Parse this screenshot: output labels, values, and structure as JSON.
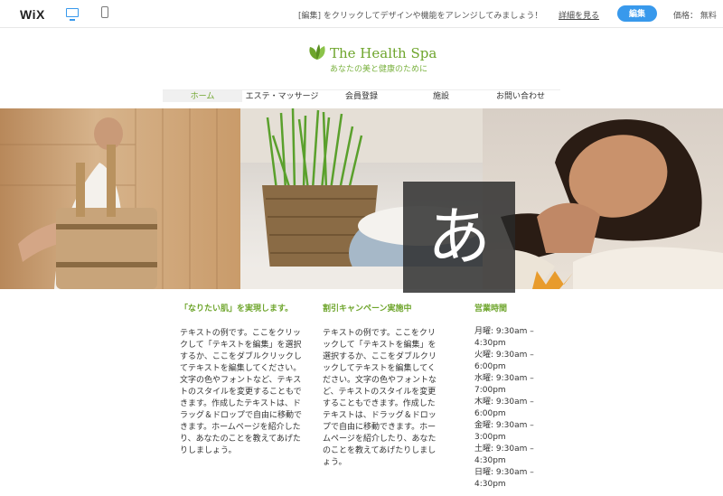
{
  "editor_bar": {
    "logo": "WiX",
    "promo": "[編集] をクリックしてデザインや機能をアレンジしてみましょう！",
    "details_link": "詳細を見る",
    "edit_button": "編集",
    "price": "価格： 無料"
  },
  "site": {
    "title": "The Health Spa",
    "subtitle": "あなたの美と健康のために"
  },
  "nav": {
    "items": [
      "ホーム",
      "エステ・マッサージ",
      "会員登録",
      "施設",
      "お問い合わせ"
    ],
    "active_index": 0
  },
  "overlay_glyph": "あ",
  "col1": {
    "heading": "「なりたい肌」を実現します。",
    "body": "テキストの例です。ここをクリックして「テキストを編集」を選択するか、ここをダブルクリックしてテキストを編集してください。文字の色やフォントなど、テキストのスタイルを変更することもできます。作成したテキストは、ドラッグ＆ドロップで自由に移動できます。ホームページを紹介したり、あなたのことを教えてあげたりしましょう。"
  },
  "col2": {
    "heading": "割引キャンペーン実施中",
    "body": "テキストの例です。ここをクリックして「テキストを編集」を選択するか、ここをダブルクリックしてテキストを編集してください。文字の色やフォントなど、テキストのスタイルを変更することもできます。作成したテキストは、ドラッグ＆ドロップで自由に移動できます。ホームページを紹介したり、あなたのことを教えてあげたりしましょう。"
  },
  "hours": {
    "heading": "営業時間",
    "rows": [
      "月曜: 9:30am – 4:30pm",
      "火曜: 9:30am – 6:00pm",
      "水曜: 9:30am – 7:00pm",
      "木曜: 9:30am – 6:00pm",
      "金曜: 9:30am – 3:00pm",
      "土曜: 9:30am – 4:30pm",
      "日曜: 9:30am – 4:30pm"
    ]
  },
  "colors": {
    "accent_green": "#6ea52c",
    "edit_blue": "#3899ec"
  },
  "icons": [
    "desktop-icon",
    "mobile-icon",
    "leaf-logo-icon"
  ]
}
